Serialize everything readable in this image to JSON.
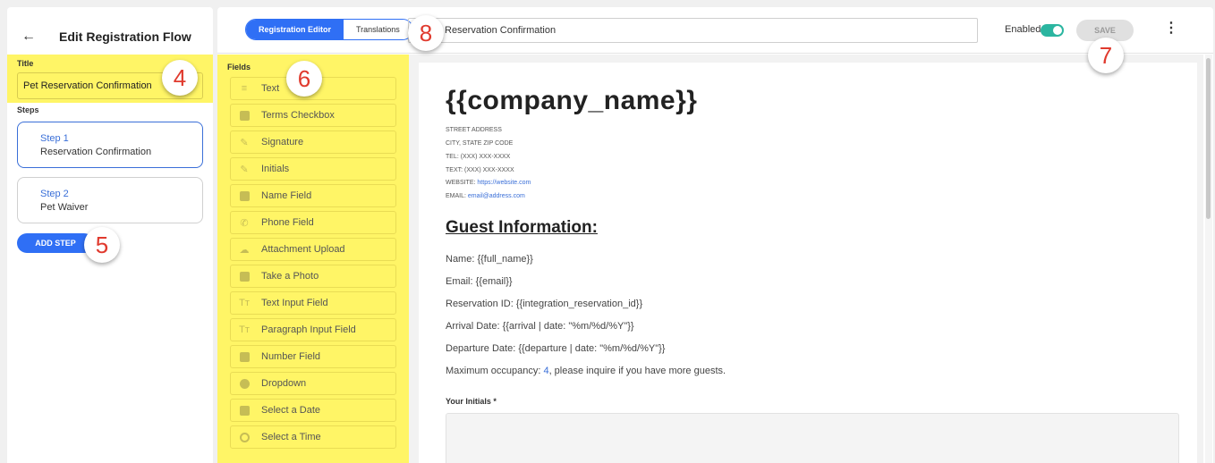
{
  "sidebar": {
    "back_icon": "arrow-left-icon",
    "title": "Edit Registration Flow",
    "title_label": "Title",
    "title_value": "Pet Reservation Confirmation",
    "steps_label": "Steps",
    "steps": [
      {
        "number": "Step 1",
        "name": "Reservation Confirmation",
        "active": true
      },
      {
        "number": "Step 2",
        "name": "Pet Waiver",
        "active": false
      }
    ],
    "add_step_label": "ADD STEP"
  },
  "toolbar": {
    "tab_editor": "Registration Editor",
    "tab_translations": "Translations",
    "name_value": "Reservation Confirmation",
    "enabled_label": "Enabled",
    "enabled": true,
    "save_label": "SAVE",
    "menu_icon": "more-vertical-icon"
  },
  "fields": {
    "label": "Fields",
    "items": [
      {
        "label": "Text",
        "icon": "text-lines-icon"
      },
      {
        "label": "Terms Checkbox",
        "icon": "checkbox-icon"
      },
      {
        "label": "Signature",
        "icon": "pen-icon"
      },
      {
        "label": "Initials",
        "icon": "pen-icon"
      },
      {
        "label": "Name Field",
        "icon": "person-icon"
      },
      {
        "label": "Phone Field",
        "icon": "phone-icon"
      },
      {
        "label": "Attachment Upload",
        "icon": "cloud-upload-icon"
      },
      {
        "label": "Take a Photo",
        "icon": "camera-icon"
      },
      {
        "label": "Text Input Field",
        "icon": "text-size-icon"
      },
      {
        "label": "Paragraph Input Field",
        "icon": "text-size-icon"
      },
      {
        "label": "Number Field",
        "icon": "number-icon"
      },
      {
        "label": "Dropdown",
        "icon": "dropdown-icon"
      },
      {
        "label": "Select a Date",
        "icon": "calendar-icon"
      },
      {
        "label": "Select a Time",
        "icon": "clock-icon"
      }
    ]
  },
  "document": {
    "company": "{{company_name}}",
    "street": "STREET ADDRESS",
    "city": "CITY, STATE ZIP CODE",
    "tel": "TEL: (XXX) XXX-XXXX",
    "text": "TEXT: (XXX) XXX-XXXX",
    "website_label": "WEBSITE: ",
    "website": "https://website.com",
    "email_label": "EMAIL: ",
    "email": "email@address.com",
    "heading": "Guest Information:",
    "lines": [
      "Name: {{full_name}}",
      "Email: {{email}}",
      "Reservation ID: {{integration_reservation_id}}",
      "Arrival Date: {{arrival | date: \"%m/%d/%Y\"}}",
      "Departure Date: {{departure | date: \"%m/%d/%Y\"}}"
    ],
    "occupancy_prefix": "Maximum occupancy: ",
    "occupancy_value": "4",
    "occupancy_suffix": ", please inquire if you have more guests.",
    "initials_label": "Your Initials *"
  },
  "badges": {
    "title": "4",
    "add_step": "5",
    "fields": "6",
    "save": "7",
    "translations": "8"
  },
  "colors": {
    "primary": "#2f6ff5",
    "highlight": "#fff566",
    "badge_text": "#e03a2e",
    "toggle": "#2bb5a0"
  }
}
